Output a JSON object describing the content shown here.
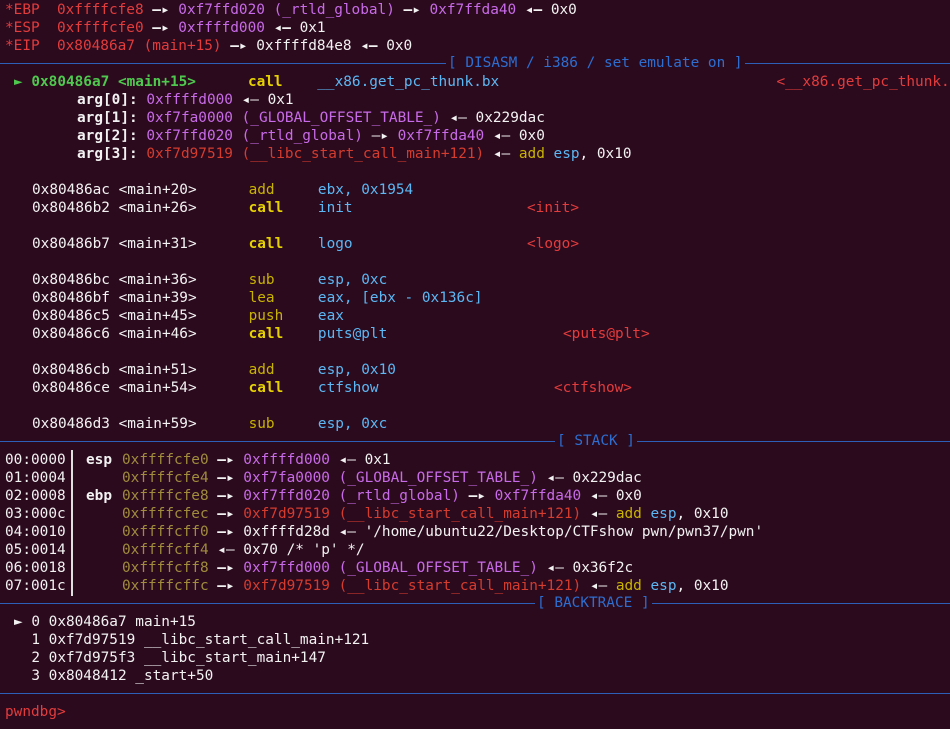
{
  "registers": [
    {
      "name": "*EBP",
      "addr": "0xffffcfe8",
      "chain": [
        {
          "text": "0xf7ffd020 (_rtld_global)",
          "cls": "mag"
        },
        {
          "text": "0xf7ffda40",
          "cls": "mag"
        }
      ],
      "tail": "0x0"
    },
    {
      "name": "*ESP",
      "addr": "0xffffcfe0",
      "chain": [
        {
          "text": "0xffffd000",
          "cls": "mag"
        }
      ],
      "tail": "0x1"
    },
    {
      "name": "*EIP",
      "addr": "0x80486a7 (main+15)",
      "chain": [
        {
          "text": "0xffffd84e8",
          "cls": "white"
        }
      ],
      "tail": "0x0"
    }
  ],
  "sections": {
    "disasm": "[ DISASM / i386 / set emulate on ]",
    "stack": "[ STACK ]",
    "backtrace": "[ BACKTRACE ]"
  },
  "disasm": {
    "current": {
      "marker": "►",
      "addr": "0x80486a7",
      "sym": "<main+15>",
      "mnemonic": "call",
      "operand": "__x86.get_pc_thunk.bx",
      "target": "<__x86.get_pc_thunk.bx>"
    },
    "args": [
      {
        "label": "arg[0]:",
        "addr": "0xffffd000",
        "addr_cls": "mag",
        "rest": "◂— 0x1",
        "suffix": ""
      },
      {
        "label": "arg[1]:",
        "addr": "0xf7fa0000 (_GLOBAL_OFFSET_TABLE_)",
        "addr_cls": "mag",
        "rest": "◂— 0x229dac",
        "suffix": ""
      },
      {
        "label": "arg[2]:",
        "addr": "0xf7ffd020 (_rtld_global)",
        "addr_cls": "mag",
        "rest": "—▸",
        "suffix": "0xf7ffda40 ◂— 0x0"
      },
      {
        "label": "arg[3]:",
        "addr": "0xf7d97519 (__libc_start_call_main+121)",
        "addr_cls": "dred",
        "rest": "◂—",
        "suffix": "add esp, 0x10"
      }
    ],
    "instructions": [
      {
        "addr": "0x80486ac",
        "sym": "<main+20>",
        "mnemonic": "add",
        "bold": false,
        "operand": "ebx, 0x1954",
        "target": ""
      },
      {
        "addr": "0x80486b2",
        "sym": "<main+26>",
        "mnemonic": "call",
        "bold": true,
        "operand": "init",
        "target": "<init>"
      },
      {
        "addr": "0x80486b7",
        "sym": "<main+31>",
        "mnemonic": "call",
        "bold": true,
        "operand": "logo",
        "target": "<logo>"
      },
      {
        "addr": "0x80486bc",
        "sym": "<main+36>",
        "mnemonic": "sub",
        "bold": false,
        "operand": "esp, 0xc",
        "target": ""
      },
      {
        "addr": "0x80486bf",
        "sym": "<main+39>",
        "mnemonic": "lea",
        "bold": false,
        "operand": "eax, [ebx - 0x136c]",
        "target": ""
      },
      {
        "addr": "0x80486c5",
        "sym": "<main+45>",
        "mnemonic": "push",
        "bold": false,
        "operand": "eax",
        "target": ""
      },
      {
        "addr": "0x80486c6",
        "sym": "<main+46>",
        "mnemonic": "call",
        "bold": true,
        "operand": "puts@plt",
        "target": "<puts@plt>"
      },
      {
        "addr": "0x80486cb",
        "sym": "<main+51>",
        "mnemonic": "add",
        "bold": false,
        "operand": "esp, 0x10",
        "target": ""
      },
      {
        "addr": "0x80486ce",
        "sym": "<main+54>",
        "mnemonic": "call",
        "bold": true,
        "operand": "ctfshow",
        "target": "<ctfshow>"
      },
      {
        "addr": "0x80486d3",
        "sym": "<main+59>",
        "mnemonic": "sub",
        "bold": false,
        "operand": "esp, 0xc",
        "target": ""
      }
    ]
  },
  "stack": [
    {
      "idx": "00:0000",
      "reg": "esp",
      "addr": "0xffffcfe0",
      "value": "0xffffd000",
      "value_cls": "mag",
      "rest": "◂— 0x1"
    },
    {
      "idx": "01:0004",
      "reg": "",
      "addr": "0xffffcfe4",
      "value": "0xf7fa0000 (_GLOBAL_OFFSET_TABLE_)",
      "value_cls": "mag",
      "rest": "◂— 0x229dac"
    },
    {
      "idx": "02:0008",
      "reg": "ebp",
      "addr": "0xffffcfe8",
      "value": "0xf7ffd020 (_rtld_global)",
      "value_cls": "mag",
      "rest": "—▸ 0xf7ffda40 ◂— 0x0"
    },
    {
      "idx": "03:000c",
      "reg": "",
      "addr": "0xffffcfec",
      "value": "0xf7d97519 (__libc_start_call_main+121)",
      "value_cls": "dred",
      "rest": "◂— add esp, 0x10"
    },
    {
      "idx": "04:0010",
      "reg": "",
      "addr": "0xffffcff0",
      "value": "0xffffd28d",
      "value_cls": "white",
      "rest": "◂— '/home/ubuntu22/Desktop/CTFshow pwn/pwn37/pwn'"
    },
    {
      "idx": "05:0014",
      "reg": "",
      "addr": "0xffffcff4",
      "value": "",
      "value_cls": "white",
      "rest": "◂— 0x70 /* 'p' */"
    },
    {
      "idx": "06:0018",
      "reg": "",
      "addr": "0xffffcff8",
      "value": "0xf7ffd000 (_GLOBAL_OFFSET_TABLE_)",
      "value_cls": "mag",
      "rest": "◂— 0x36f2c"
    },
    {
      "idx": "07:001c",
      "reg": "",
      "addr": "0xffffcffc",
      "value": "0xf7d97519 (__libc_start_call_main+121)",
      "value_cls": "dred",
      "rest": "◂— add esp, 0x10"
    }
  ],
  "backtrace": [
    {
      "marker": "►",
      "text": "0 0x80486a7 main+15"
    },
    {
      "marker": "",
      "text": "1 0xf7d97519 __libc_start_call_main+121"
    },
    {
      "marker": "",
      "text": "2 0xf7d975f3 __libc_start_main+147"
    },
    {
      "marker": "",
      "text": "3 0x8048412 _start+50"
    }
  ],
  "prompt": "pwndbg>"
}
